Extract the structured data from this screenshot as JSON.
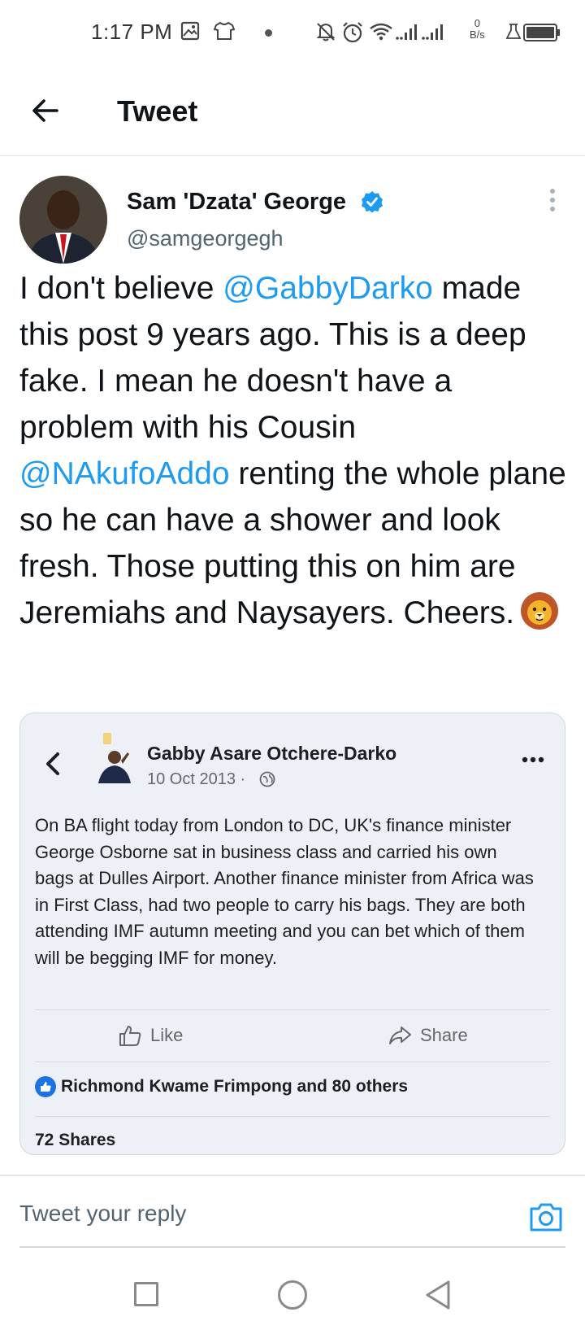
{
  "status_bar": {
    "time": "1:17 PM",
    "net_speed_value": "0",
    "net_speed_unit": "B/s",
    "icons": [
      "gallery-icon",
      "tshirt-icon",
      "notifications-off-icon",
      "alarm-icon",
      "wifi-icon",
      "signal-icon",
      "signal-icon",
      "flask-icon",
      "battery-icon"
    ]
  },
  "header": {
    "title": "Tweet"
  },
  "tweet": {
    "author_name": "Sam 'Dzata' George",
    "author_handle": "@samgeorgegh",
    "verified": true,
    "text_parts": {
      "p1": "I don't believe ",
      "mention1": "@GabbyDarko",
      "p2": " made this post 9 years ago. This is a deep fake. I mean he doesn't have a problem with his Cousin ",
      "mention2": "@NAkufoAddo",
      "p3": " renting the whole plane so he can have a shower and look fresh. Those putting this on him are Jeremiahs and Naysayers. Cheers."
    },
    "mention_color": "#1d9bf0"
  },
  "embedded_post": {
    "author_name": "Gabby Asare Otchere-Darko",
    "date": "10 Oct 2013 ·",
    "body": "On BA flight today from London to DC, UK's finance minister George Osborne sat in business class and carried his own bags at Dulles Airport. Another finance minister from Africa was in First Class, had two people to carry his bags. They are both attending IMF autumn meeting and you can bet which of them will be begging IMF for money.",
    "like_label": "Like",
    "share_label": "Share",
    "reactions_text": "Richmond Kwame Frimpong and 80 others",
    "shares_text": "72 Shares"
  },
  "reply": {
    "placeholder": "Tweet your reply"
  },
  "colors": {
    "accent": "#1d9bf0",
    "card_background": "#edf0f6",
    "fb_blue": "#1b74e4"
  }
}
